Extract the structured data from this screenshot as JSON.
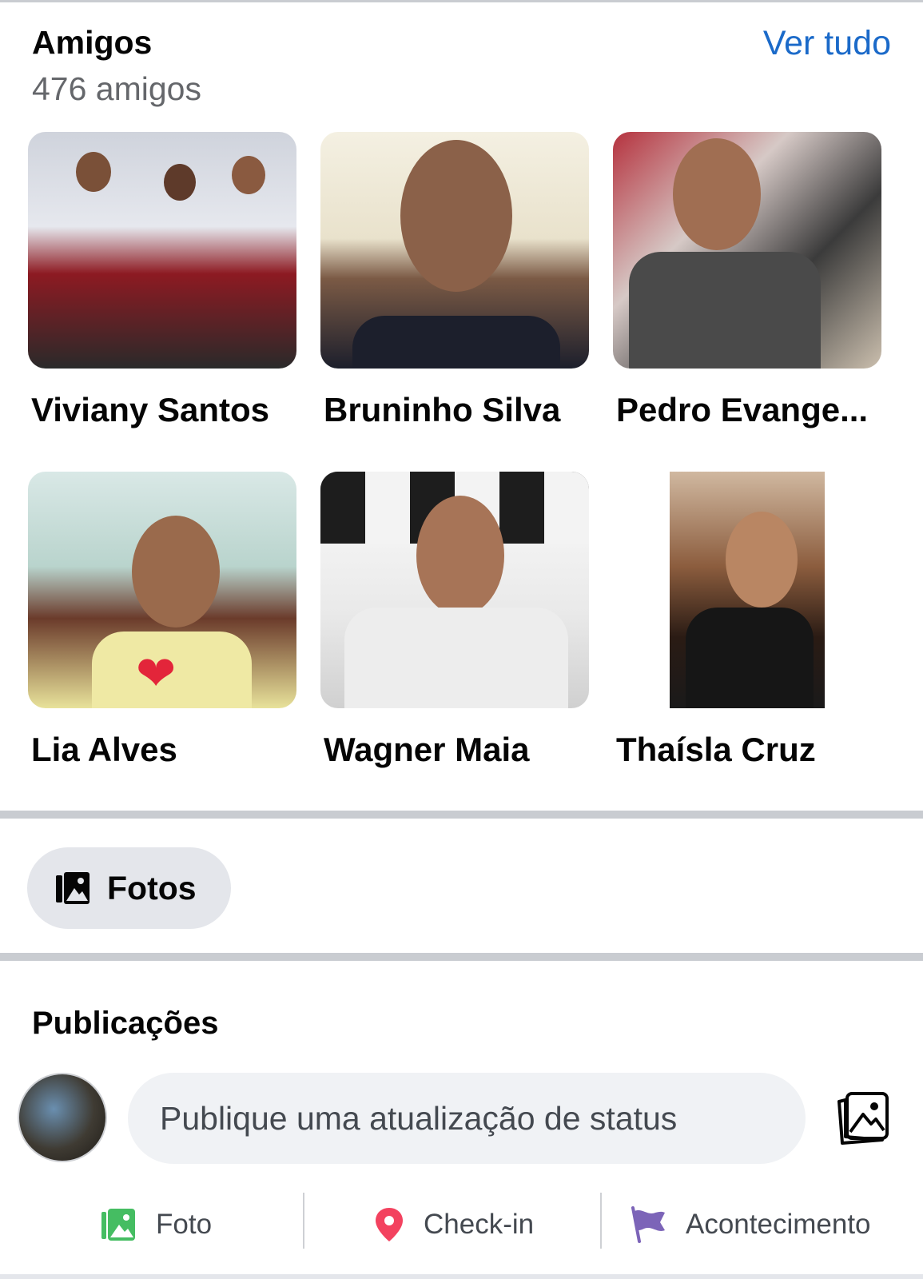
{
  "friends": {
    "title": "Amigos",
    "count_label": "476 amigos",
    "see_all_label": "Ver tudo",
    "items": [
      {
        "name": "Viviany Santos"
      },
      {
        "name": "Bruninho Silva"
      },
      {
        "name": "Pedro Evange..."
      },
      {
        "name": "Lia Alves"
      },
      {
        "name": "Wagner Maia"
      },
      {
        "name": "Thaísla Cruz"
      }
    ]
  },
  "photos_tab": {
    "label": "Fotos",
    "icon": "photo-album-icon"
  },
  "publications": {
    "title": "Publicações",
    "status_placeholder": "Publique uma atualização de status",
    "actions": [
      {
        "label": "Foto",
        "icon": "photo-icon",
        "color": "#45bd62"
      },
      {
        "label": "Check-in",
        "icon": "location-pin-icon",
        "color": "#f3425f"
      },
      {
        "label": "Acontecimento",
        "icon": "flag-icon",
        "color": "#7c64b8"
      }
    ]
  },
  "colors": {
    "link": "#1b6ac9",
    "divider": "#c9ccd1",
    "pill": "#e4e6eb"
  }
}
